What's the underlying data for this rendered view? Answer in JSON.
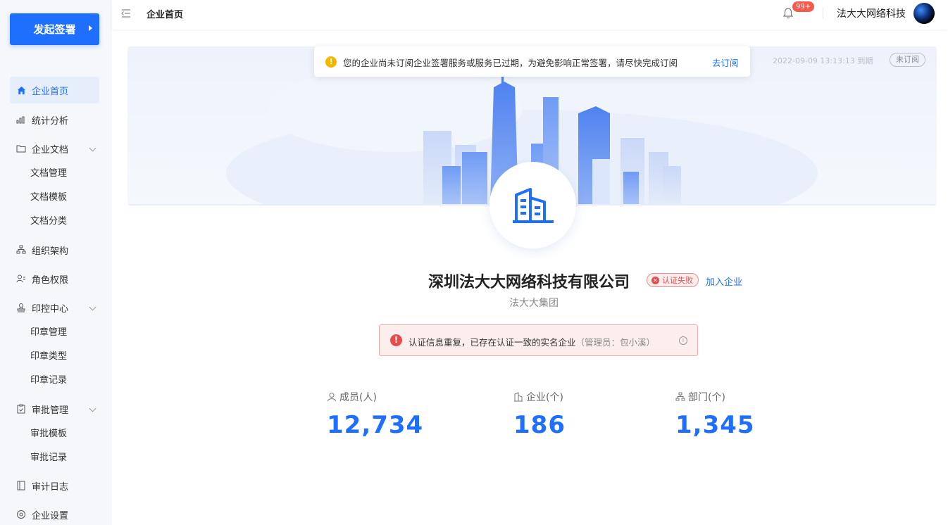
{
  "sidebar": {
    "start_button": "发起签署",
    "items": [
      {
        "label": "企业首页",
        "icon": "home-icon",
        "active": true
      },
      {
        "label": "统计分析",
        "icon": "bar-chart-icon"
      },
      {
        "label": "企业文档",
        "icon": "folder-icon"
      },
      {
        "label": "文档管理"
      },
      {
        "label": "文档模板"
      },
      {
        "label": "文档分类"
      },
      {
        "label": "组织架构",
        "icon": "org-icon"
      },
      {
        "label": "角色权限",
        "icon": "role-icon"
      },
      {
        "label": "印控中心",
        "icon": "stamp-icon"
      },
      {
        "label": "印章管理"
      },
      {
        "label": "印章类型"
      },
      {
        "label": "印章记录"
      },
      {
        "label": "审批管理",
        "icon": "clipboard-icon"
      },
      {
        "label": "审批模板"
      },
      {
        "label": "审批记录"
      },
      {
        "label": "审计日志",
        "icon": "log-icon"
      },
      {
        "label": "企业设置",
        "icon": "settings-icon"
      }
    ]
  },
  "header": {
    "title": "企业首页",
    "badge": "99+",
    "company": "法大大网络科技"
  },
  "banner": {
    "date": "2022-09-09 13:13:13 到期",
    "tag": "未订阅"
  },
  "notice": {
    "message": "您的企业尚未订阅企业签署服务或服务已过期，为避免影响正常签署，请尽快完成订阅",
    "link": "去订阅"
  },
  "company": {
    "name": "深圳法大大网络科技有限公司",
    "status": "认证失败",
    "join": "加入企业",
    "group": "法大大集团"
  },
  "error": {
    "message": "认证信息重复，已存在认证一致的实名企业",
    "admin": "（管理员：包小溪）"
  },
  "stats": [
    {
      "label": "成员(人)",
      "value": "12,734"
    },
    {
      "label": "企业(个)",
      "value": "186"
    },
    {
      "label": "部门(个)",
      "value": "1,345"
    }
  ],
  "colors": {
    "accent": "#1f6fff",
    "danger": "#e84c4c",
    "warning": "#f5b700"
  }
}
